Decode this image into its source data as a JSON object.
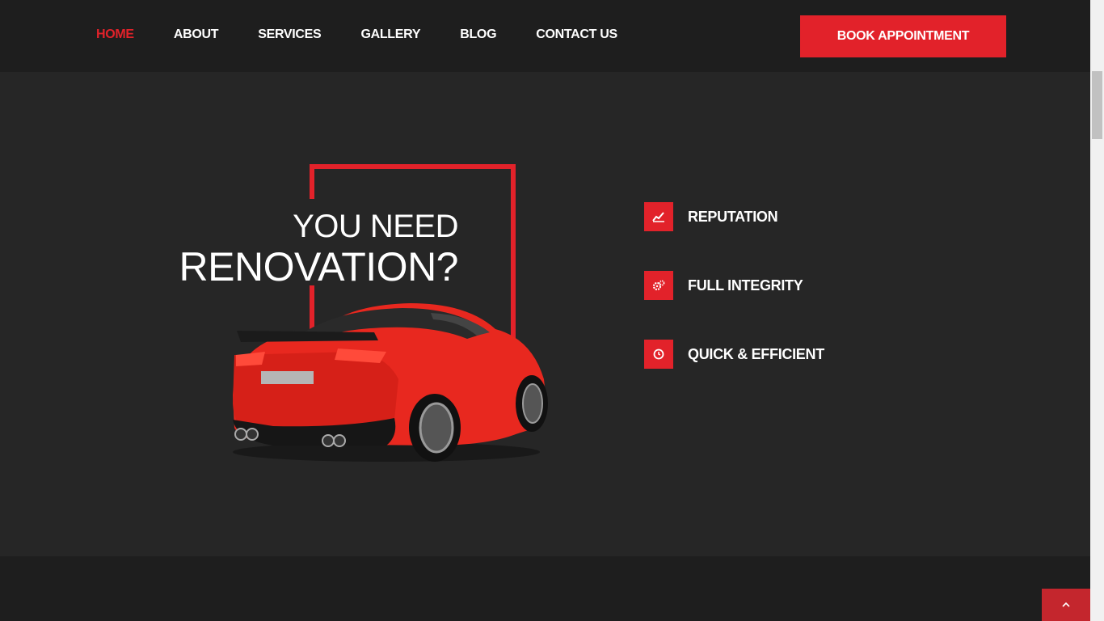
{
  "nav": {
    "items": [
      {
        "label": "HOME",
        "active": true
      },
      {
        "label": "ABOUT",
        "active": false
      },
      {
        "label": "SERVICES",
        "active": false
      },
      {
        "label": "GALLERY",
        "active": false
      },
      {
        "label": "BLOG",
        "active": false
      },
      {
        "label": "CONTACT US",
        "active": false
      }
    ],
    "cta_label": "BOOK APPOINTMENT"
  },
  "hero": {
    "title_line1": "YOU NEED",
    "title_line2": "RENOVATION?",
    "car_image": "red-sports-car"
  },
  "features": [
    {
      "label": "REPUTATION",
      "icon": "trend-chart-icon"
    },
    {
      "label": "FULL INTEGRITY",
      "icon": "gears-icon"
    },
    {
      "label": "QUICK & EFFICIENT",
      "icon": "clock-icon"
    }
  ],
  "colors": {
    "accent": "#e2222a",
    "header_bg": "#1e1e1e",
    "hero_bg": "#262626"
  },
  "scroll_top_icon": "chevron-up-icon"
}
